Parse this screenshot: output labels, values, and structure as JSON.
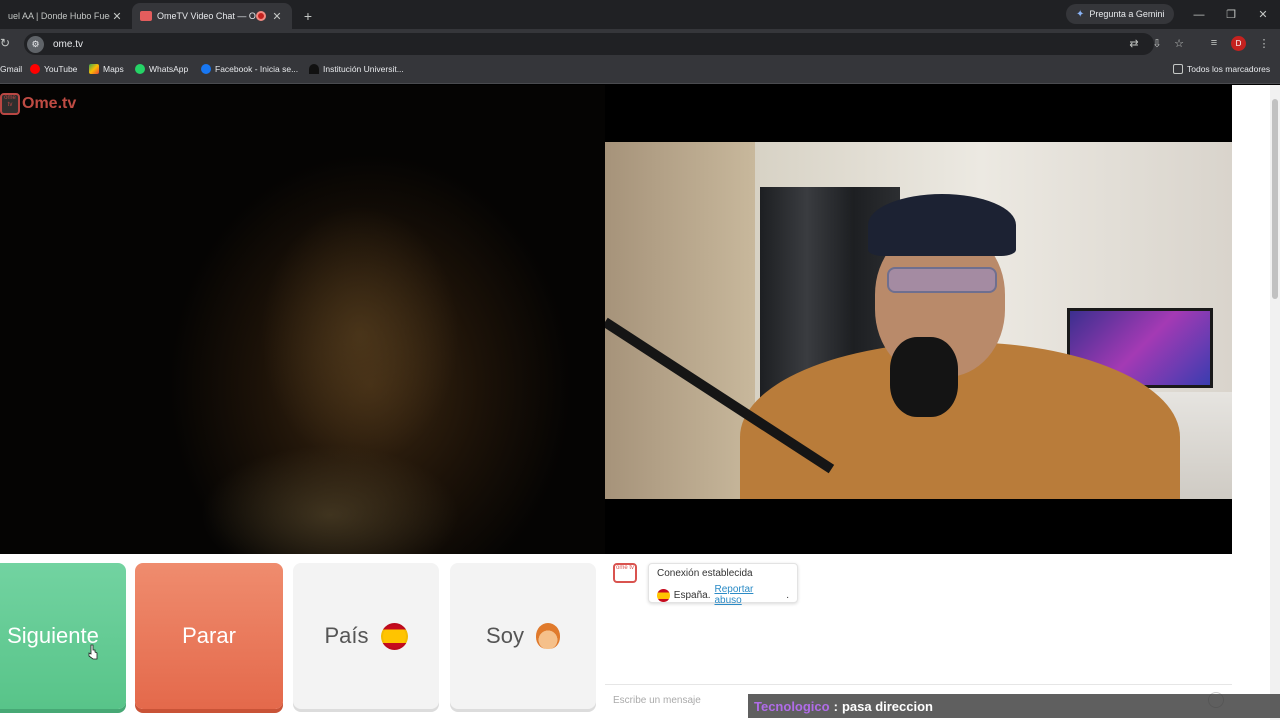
{
  "browser": {
    "tabs": [
      {
        "title": "uel AA | Donde Hubo Fuego",
        "active": false
      },
      {
        "title": "OmeTV Video Chat — Ome",
        "active": true
      }
    ],
    "gemini_label": "Pregunta a Gemini",
    "url": "ome.tv",
    "profile_initial": "D",
    "bookmarks": [
      {
        "label": "Gmail",
        "icon": "gmail-icon"
      },
      {
        "label": "YouTube",
        "icon": "youtube-icon"
      },
      {
        "label": "Maps",
        "icon": "maps-icon"
      },
      {
        "label": "WhatsApp",
        "icon": "whatsapp-icon"
      },
      {
        "label": "Facebook - Inicia se...",
        "icon": "facebook-icon"
      },
      {
        "label": "Institución Universit...",
        "icon": "institution-icon"
      }
    ],
    "all_bookmarks_label": "Todos los marcadores"
  },
  "app": {
    "logo_text": "Ome.tv",
    "logo_badge": "ome tv",
    "buttons": {
      "next": "Siguiente",
      "stop": "Parar",
      "country": "País",
      "gender": "Soy"
    },
    "chat": {
      "status": "Conexión establecida",
      "country": "España.",
      "report_link": "Reportar abuso",
      "report_suffix": ".",
      "input_placeholder": "Escribe un mensaje"
    }
  },
  "stream_overlay": {
    "user": "Tecnologico",
    "separator": ":",
    "message": "pasa direccion"
  },
  "colors": {
    "next_button": "#58c489",
    "stop_button": "#e4694b",
    "brand": "#e0584f",
    "link": "#2b8bc6",
    "overlay_user": "#b06ce8"
  }
}
